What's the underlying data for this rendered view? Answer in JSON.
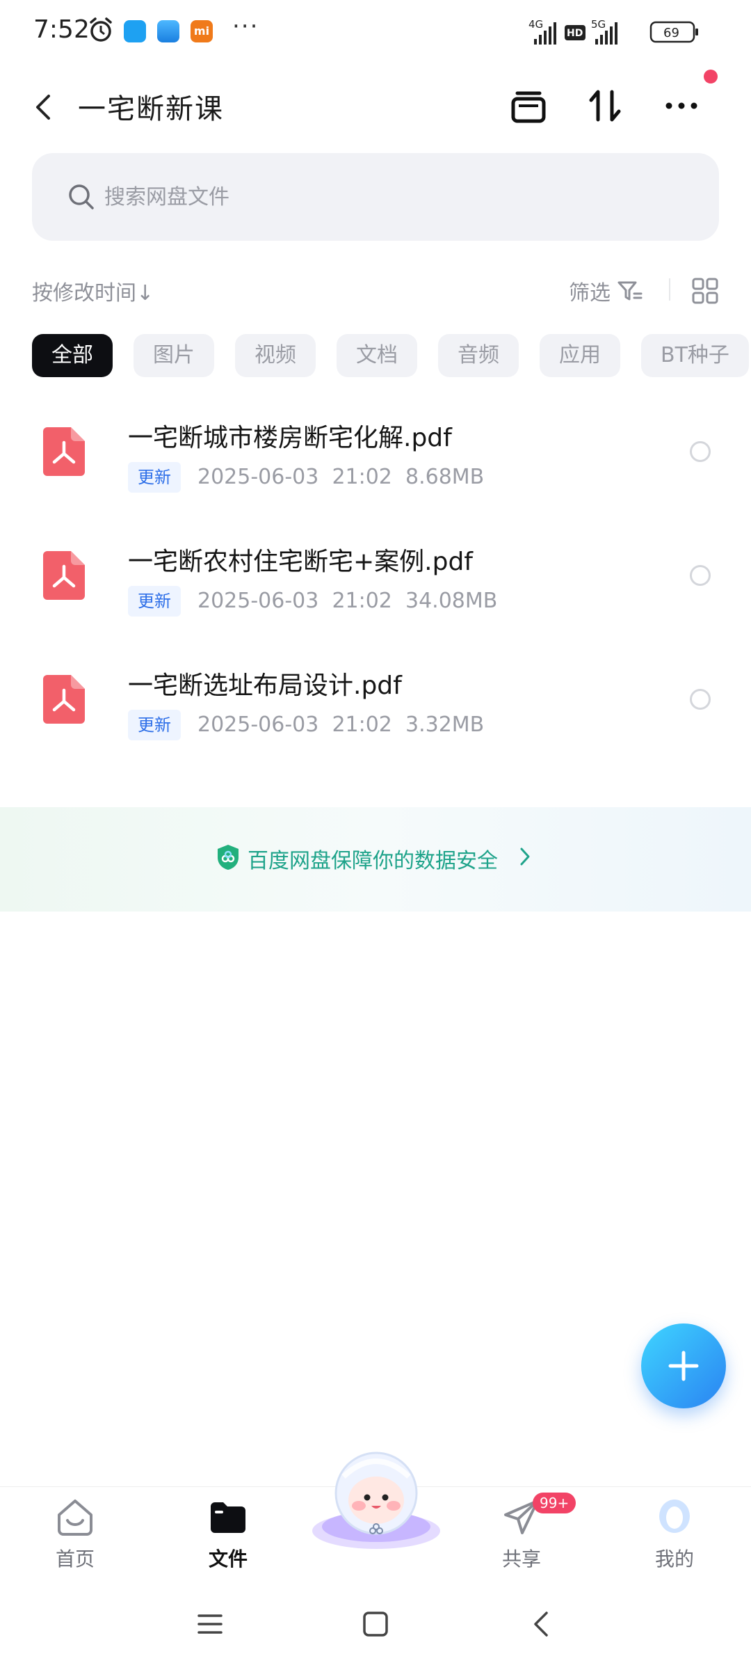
{
  "status_bar": {
    "time": "7:52",
    "app3_label": "mi",
    "more": "···",
    "net1": "4G",
    "hd": "HD",
    "net2": "5G",
    "battery": "69"
  },
  "header": {
    "title": "一宅断新课"
  },
  "search": {
    "placeholder": "搜索网盘文件"
  },
  "sort": {
    "label": "按修改时间",
    "arrow": "↓",
    "filter_label": "筛选"
  },
  "chips": [
    "全部",
    "图片",
    "视频",
    "文档",
    "音频",
    "应用",
    "BT种子"
  ],
  "files": [
    {
      "name": "一宅断城市楼房断宅化解.pdf",
      "badge": "更新",
      "date": "2025-06-03",
      "time": "21:02",
      "size": "8.68MB"
    },
    {
      "name": "一宅断农村住宅断宅+案例.pdf",
      "badge": "更新",
      "date": "2025-06-03",
      "time": "21:02",
      "size": "34.08MB"
    },
    {
      "name": "一宅断选址布局设计.pdf",
      "badge": "更新",
      "date": "2025-06-03",
      "time": "21:02",
      "size": "3.32MB"
    }
  ],
  "security_banner": {
    "text": "百度网盘保障你的数据安全"
  },
  "bottom_nav": {
    "home": "首页",
    "files": "文件",
    "share": "共享",
    "share_badge": "99+",
    "me": "我的"
  },
  "colors": {
    "accent": "#2a83f2",
    "pdf_red": "#f2606a",
    "security_green": "#1ea38a",
    "active_chip": "#0d0e12",
    "badge_red": "#f24366"
  }
}
